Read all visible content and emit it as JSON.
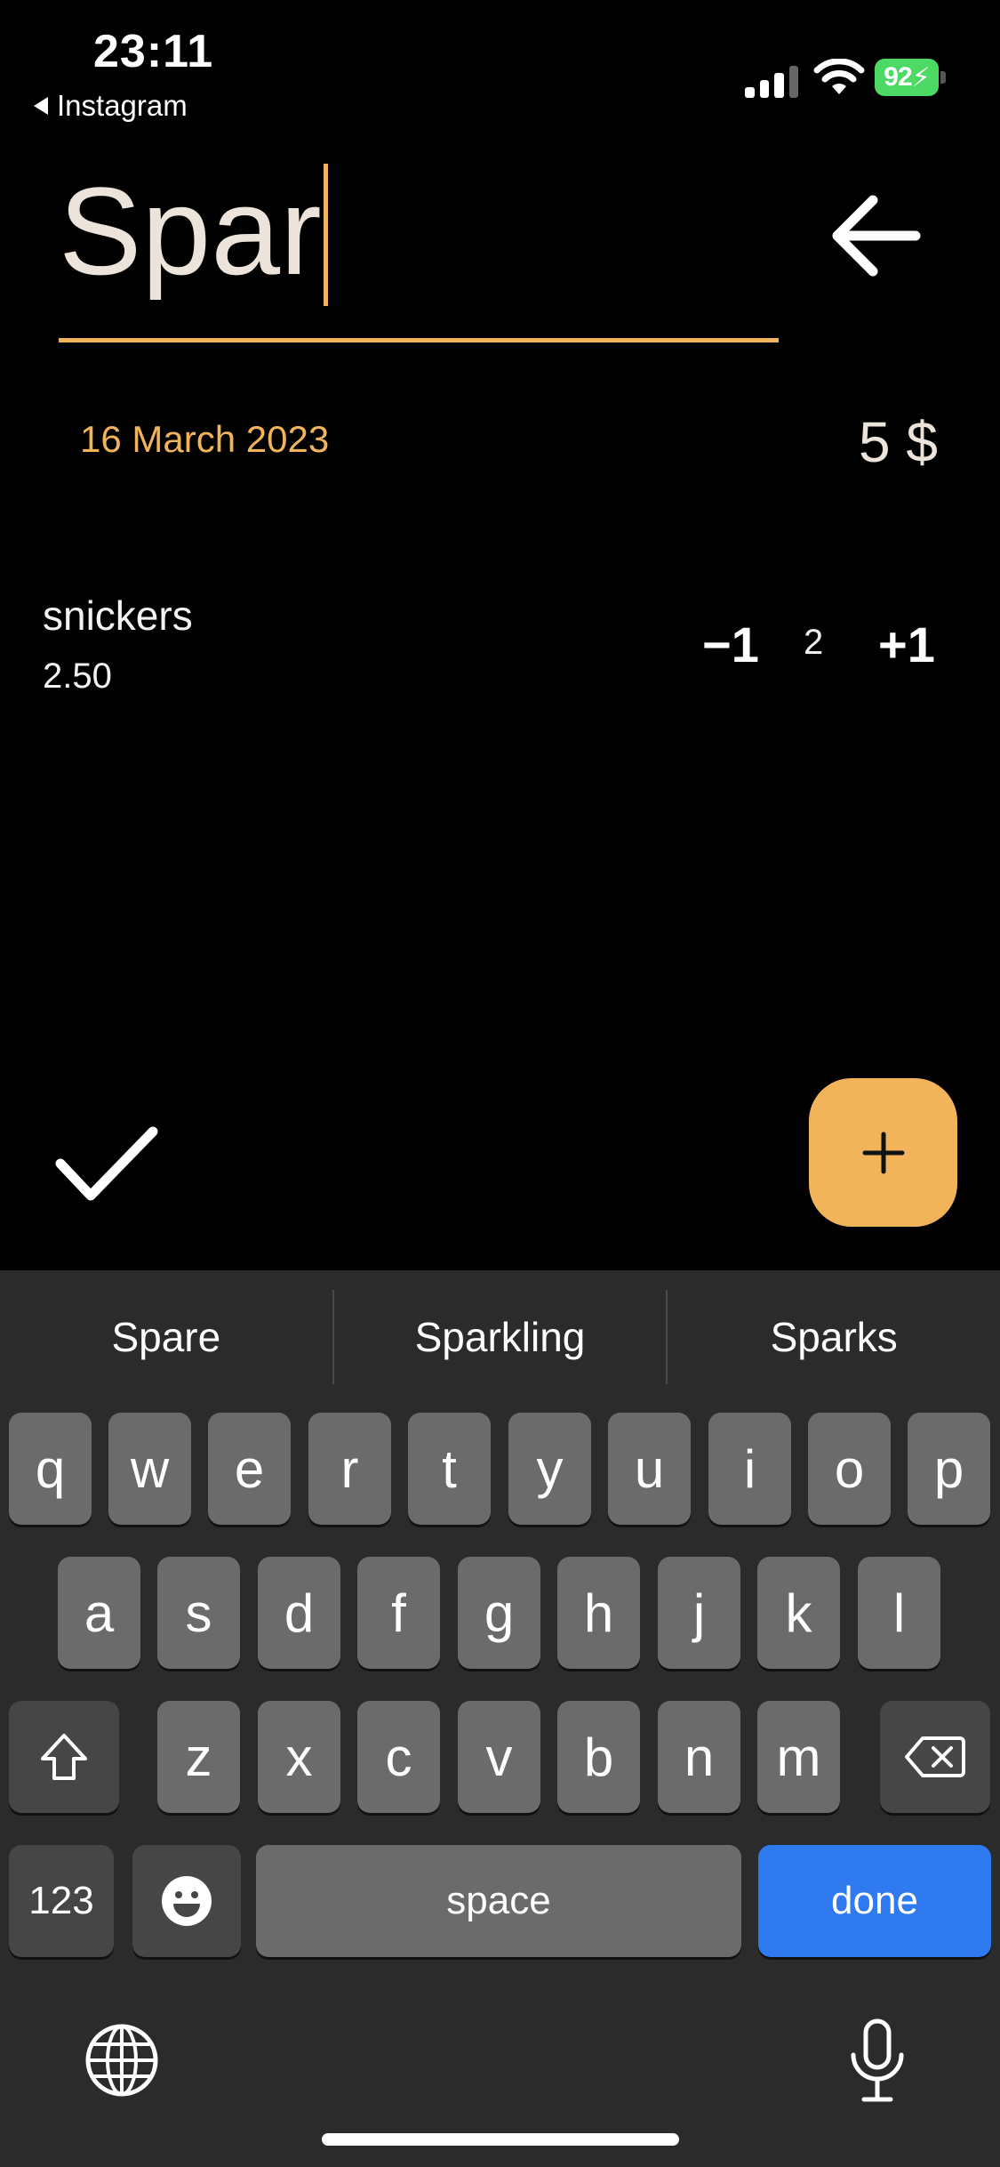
{
  "status_bar": {
    "time": "23:11",
    "back_app": "Instagram",
    "battery": "92"
  },
  "title_input": {
    "value": "Spar"
  },
  "date": "16 March 2023",
  "total": "5 $",
  "item": {
    "name": "snickers",
    "price": "2.50",
    "minus_label": "−1",
    "quantity": "2",
    "plus_label": "+1"
  },
  "fab_label": "+",
  "keyboard": {
    "suggestions": [
      "Spare",
      "Sparkling",
      "Sparks"
    ],
    "row1": [
      "q",
      "w",
      "e",
      "r",
      "t",
      "y",
      "u",
      "i",
      "o",
      "p"
    ],
    "row2": [
      "a",
      "s",
      "d",
      "f",
      "g",
      "h",
      "j",
      "k",
      "l"
    ],
    "row3": [
      "z",
      "x",
      "c",
      "v",
      "b",
      "n",
      "m"
    ],
    "numbers_label": "123",
    "space_label": "space",
    "done_label": "done"
  },
  "colors": {
    "accent": "#f2b45a",
    "keyboard_bg": "#2b2b2b",
    "key": "#6b6b6b",
    "done": "#2f7af0"
  }
}
